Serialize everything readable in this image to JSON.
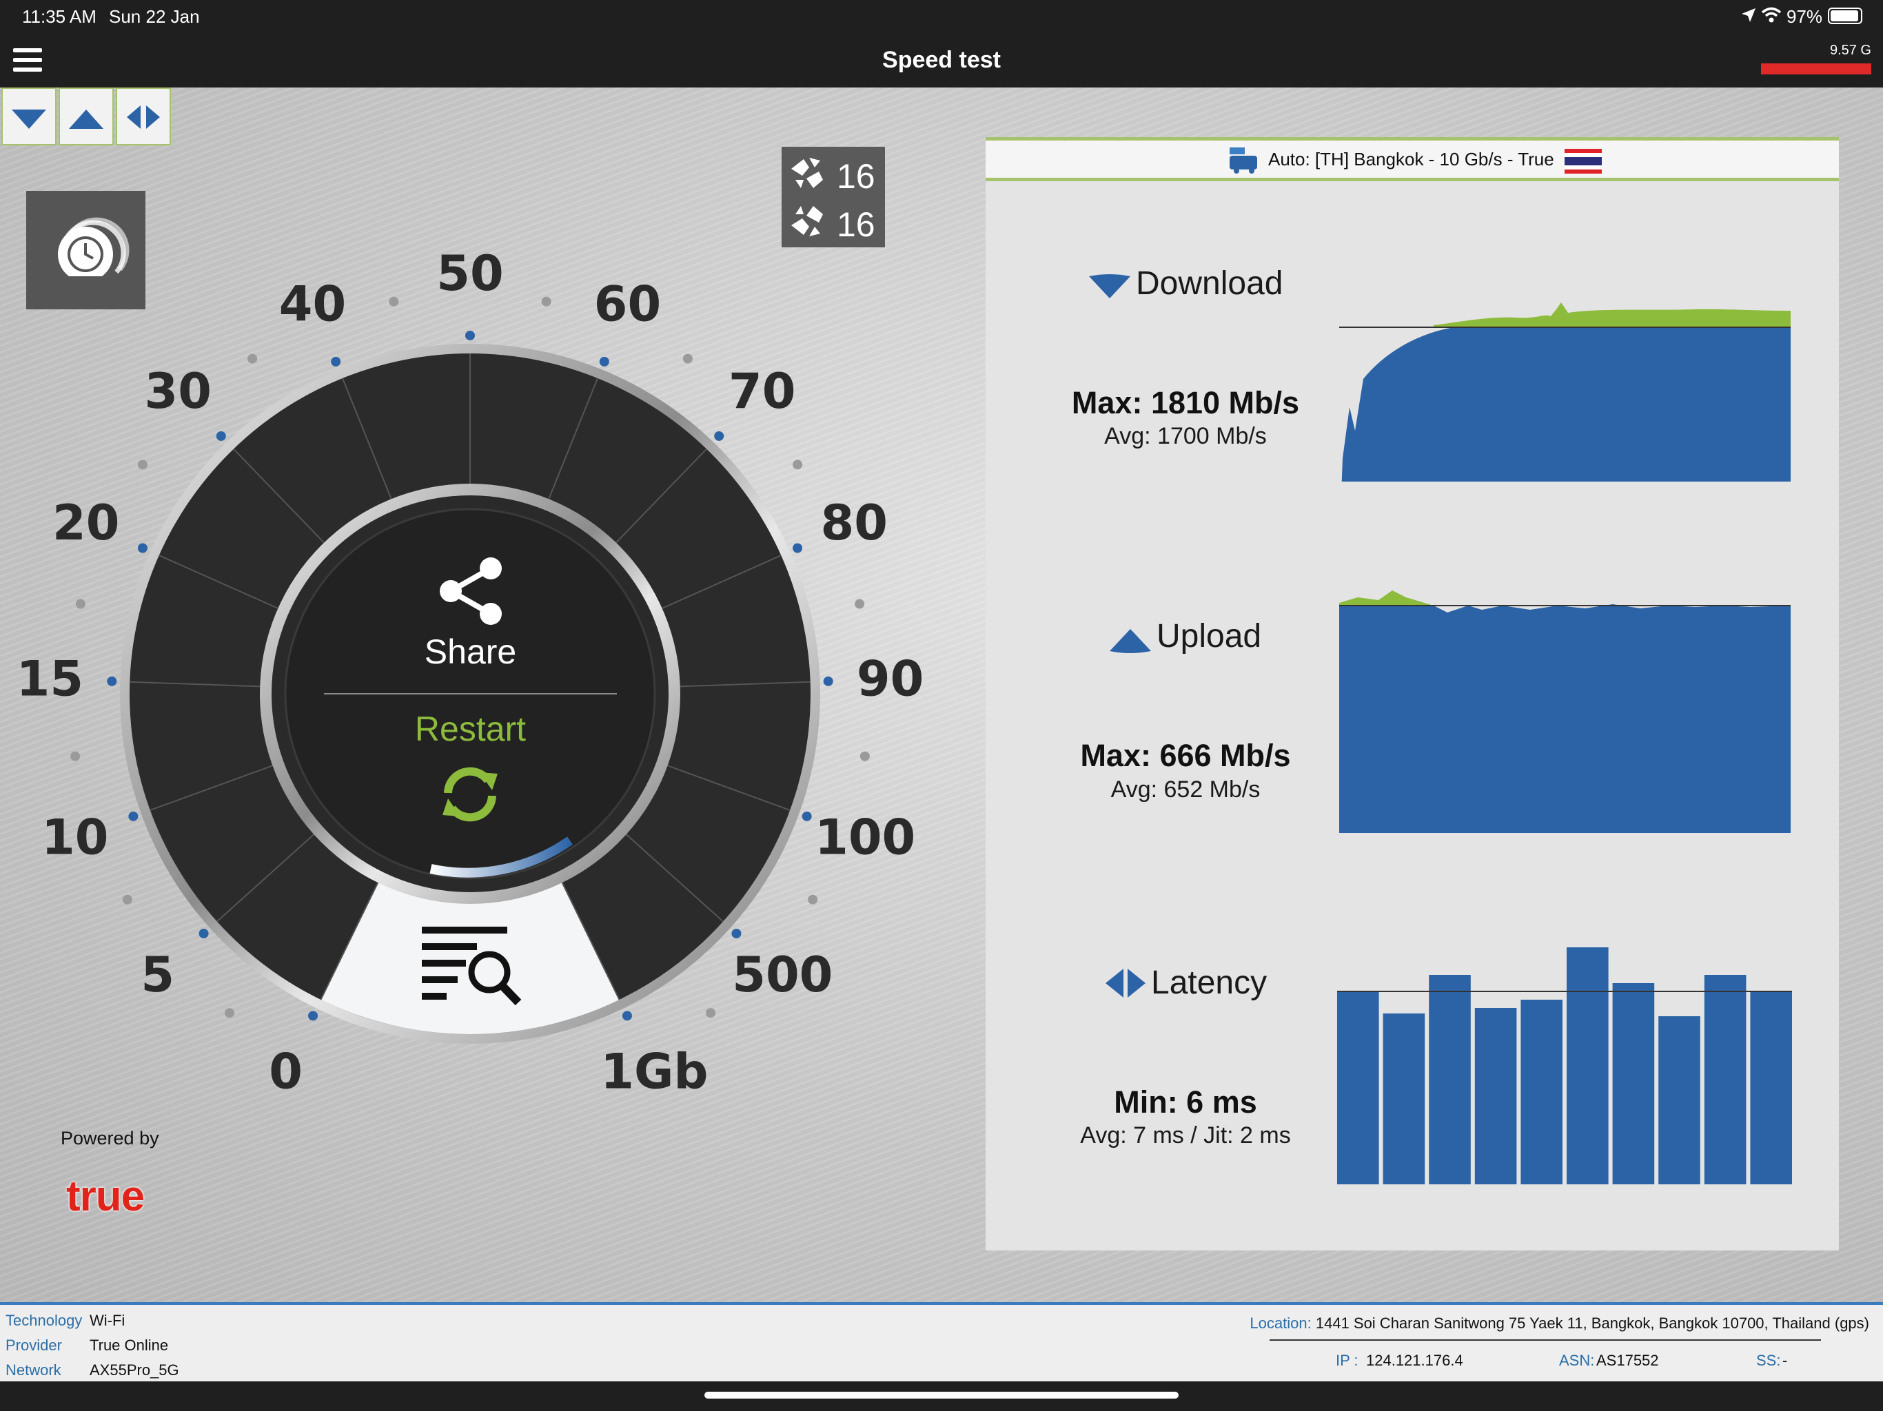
{
  "status_bar": {
    "time": "11:35 AM",
    "date": "Sun 22 Jan",
    "battery": "97%"
  },
  "title_bar": {
    "title": "Speed test",
    "data_usage": "9.57 G"
  },
  "threads": {
    "download_threads": "16",
    "upload_threads": "16"
  },
  "gauge": {
    "scale_labels": [
      "0",
      "5",
      "10",
      "15",
      "20",
      "30",
      "40",
      "50",
      "60",
      "70",
      "80",
      "90",
      "100",
      "500",
      "1Gb"
    ],
    "share_label": "Share",
    "restart_label": "Restart"
  },
  "branding": {
    "powered_by": "Powered by",
    "logo_text": "true"
  },
  "server": {
    "label": "Auto: [TH] Bangkok - 10 Gb/s - True"
  },
  "download": {
    "title": "Download",
    "max": "Max: 1810 Mb/s",
    "avg": "Avg: 1700 Mb/s"
  },
  "upload": {
    "title": "Upload",
    "max": "Max: 666 Mb/s",
    "avg": "Avg: 652 Mb/s"
  },
  "latency": {
    "title": "Latency",
    "min": "Min: 6 ms",
    "avg": "Avg: 7 ms / Jit: 2 ms",
    "bars_ms": [
      7.0,
      6.2,
      7.6,
      6.4,
      6.7,
      8.6,
      7.3,
      6.1,
      7.6,
      7.0
    ]
  },
  "info": {
    "technology_label": "Technology",
    "technology": "Wi-Fi",
    "provider_label": "Provider",
    "provider": "True Online",
    "network_label": "Network",
    "network": "AX55Pro_5G",
    "location_label": "Location:",
    "location": "1441 Soi Charan Sanitwong 75 Yaek 11, Bangkok, Bangkok 10700, Thailand (gps)",
    "ip_label": "IP :",
    "ip": "124.121.176.4",
    "asn_label": "ASN:",
    "asn": "AS17552",
    "ss_label": "SS:",
    "ss": "-"
  },
  "colors": {
    "accent_green": "#8dbb3c",
    "chart_blue": "#2c63a6",
    "usage_red": "#e02a2a"
  }
}
